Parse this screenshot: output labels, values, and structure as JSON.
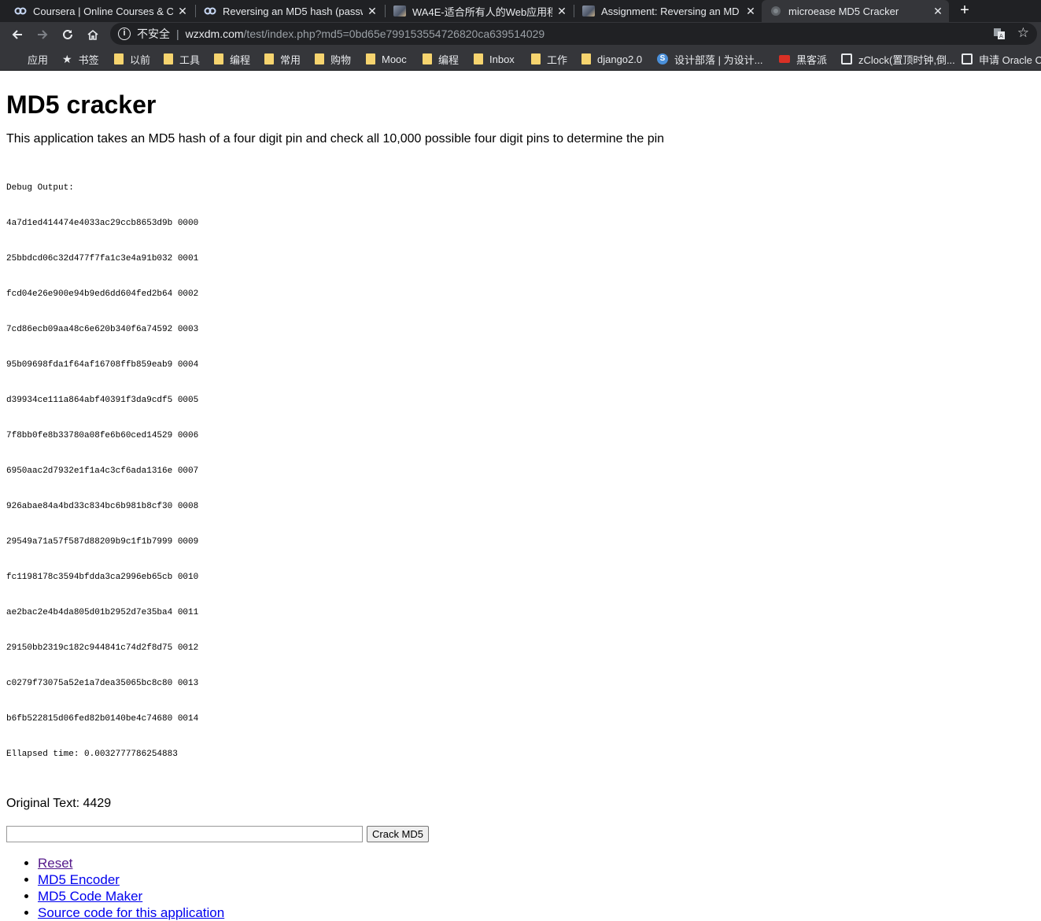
{
  "tabs": [
    {
      "title": "Coursera | Online Courses & C",
      "icon": "coursera-icon",
      "active": false
    },
    {
      "title": "Reversing an MD5 hash (passw",
      "icon": "coursera-icon",
      "active": false
    },
    {
      "title": "WA4E-适合所有人的Web应用程",
      "icon": "image-favicon",
      "active": false
    },
    {
      "title": "Assignment: Reversing an MD",
      "icon": "image-favicon",
      "active": false
    },
    {
      "title": "microease MD5 Cracker",
      "icon": "globe-icon",
      "active": true
    }
  ],
  "omnibox": {
    "security_label": "不安全",
    "host": "wzxdm.com",
    "path": "/test/index.php?md5=0bd65e799153554726820ca639514029"
  },
  "bookmarks": [
    {
      "label": "应用",
      "icon": "apps-icon"
    },
    {
      "label": "书签",
      "icon": "star-icon"
    },
    {
      "label": "以前",
      "icon": "folder-icon"
    },
    {
      "label": "工具",
      "icon": "folder-icon"
    },
    {
      "label": "编程",
      "icon": "folder-icon"
    },
    {
      "label": "常用",
      "icon": "folder-icon"
    },
    {
      "label": "购物",
      "icon": "folder-icon"
    },
    {
      "label": "Mooc",
      "icon": "folder-icon"
    },
    {
      "label": "编程",
      "icon": "folder-icon"
    },
    {
      "label": "Inbox",
      "icon": "folder-icon"
    },
    {
      "label": "工作",
      "icon": "folder-icon"
    },
    {
      "label": "django2.0",
      "icon": "folder-icon"
    },
    {
      "label": "设计部落 | 为设计...",
      "icon": "s-logo-icon"
    },
    {
      "label": "黑客派",
      "icon": "hacker-icon"
    },
    {
      "label": "zClock(置顶时钟,倒...",
      "icon": "clock-app-icon"
    },
    {
      "label": "申请 Oracle C",
      "icon": "oracle-icon"
    }
  ],
  "page": {
    "title": "MD5 cracker",
    "description": "This application takes an MD5 hash of a four digit pin and check all 10,000 possible four digit pins to determine the pin",
    "debug_header": "Debug Output:",
    "debug_lines": [
      "4a7d1ed414474e4033ac29ccb8653d9b 0000",
      "25bbdcd06c32d477f7fa1c3e4a91b032 0001",
      "fcd04e26e900e94b9ed6dd604fed2b64 0002",
      "7cd86ecb09aa48c6e620b340f6a74592 0003",
      "95b09698fda1f64af16708ffb859eab9 0004",
      "d39934ce111a864abf40391f3da9cdf5 0005",
      "7f8bb0fe8b33780a08fe6b60ced14529 0006",
      "6950aac2d7932e1f1a4c3cf6ada1316e 0007",
      "926abae84a4bd33c834bc6b981b8cf30 0008",
      "29549a71a57f587d88209b9c1f1b7999 0009",
      "fc1198178c3594bfdda3ca2996eb65cb 0010",
      "ae2bac2e4b4da805d01b2952d7e35ba4 0011",
      "29150bb2319c182c944841c74d2f8d75 0012",
      "c0279f73075a52e1a7dea35065bc8c80 0013",
      "b6fb522815d06fed82b0140be4c74680 0014"
    ],
    "elapsed": "Ellapsed time: 0.0032777786254883",
    "original_text": "Original Text: 4429",
    "md5_input_value": "",
    "crack_button": "Crack MD5",
    "links": [
      {
        "label": "Reset",
        "visited": true
      },
      {
        "label": "MD5 Encoder",
        "visited": false
      },
      {
        "label": "MD5 Code Maker",
        "visited": false
      },
      {
        "label": "Source code for this application",
        "visited": false
      }
    ]
  }
}
